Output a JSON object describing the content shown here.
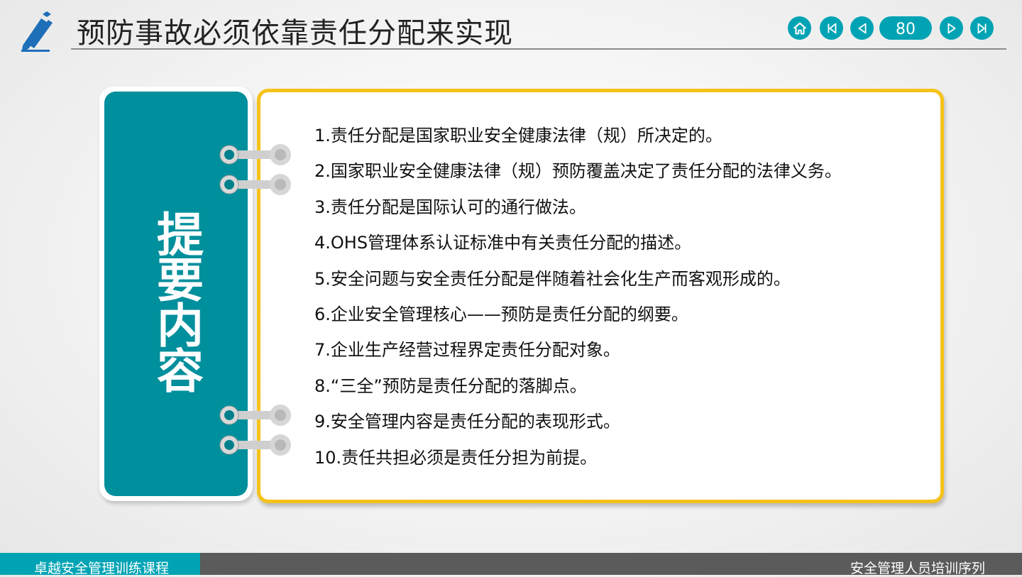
{
  "header": {
    "title": "预防事故必须依靠责任分配来实现",
    "page_number": "80",
    "nav_icons": [
      "home-icon",
      "first-page-icon",
      "previous-page-icon",
      "next-page-icon",
      "last-page-icon"
    ]
  },
  "side_panel": {
    "title": "提要内容"
  },
  "content": {
    "items": [
      "1.责任分配是国家职业安全健康法律（规）所决定的。",
      "2.国家职业安全健康法律（规）预防覆盖决定了责任分配的法律义务。",
      "3.责任分配是国际认可的通行做法。",
      "4.OHS管理体系认证标准中有关责任分配的描述。",
      "5.安全问题与安全责任分配是伴随着社会化生产而客观形成的。",
      "6.企业安全管理核心——预防是责任分配的纲要。",
      "7.企业生产经营过程界定责任分配对象。",
      "8.“三全”预防是责任分配的落脚点。",
      "9.安全管理内容是责任分配的表现形式。",
      "10.责任共担必须是责任分担为前提。"
    ]
  },
  "footer": {
    "left_text": "卓越安全管理训练课程",
    "right_text": "安全管理人员培训序列"
  },
  "colors": {
    "accent": "#00a3b4",
    "panel": "#008f9c",
    "card_border": "#f5c21a",
    "footer": "#5b5b5b"
  }
}
